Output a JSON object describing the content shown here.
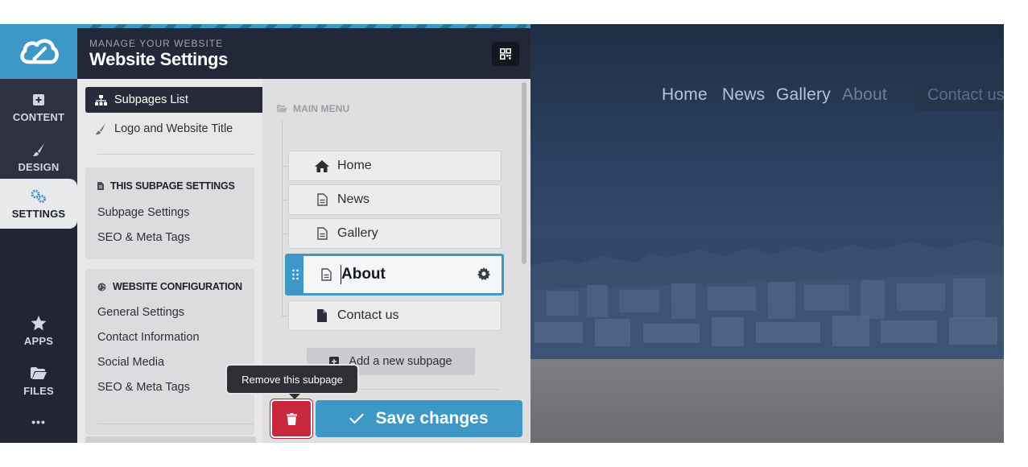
{
  "header": {
    "kicker": "MANAGE YOUR WEBSITE",
    "title": "Website Settings"
  },
  "rail": {
    "items": [
      {
        "label": "CONTENT",
        "icon": "plus-square-icon"
      },
      {
        "label": "DESIGN",
        "icon": "brush-icon"
      },
      {
        "label": "SETTINGS",
        "icon": "gears-icon",
        "active": true
      },
      {
        "label": "APPS",
        "icon": "star-icon"
      },
      {
        "label": "FILES",
        "icon": "folder-icon"
      },
      {
        "label": "•••",
        "icon": "more-icon"
      }
    ]
  },
  "settings_nav": {
    "top_items": [
      {
        "label": "Subpages List",
        "icon": "sitemap-icon",
        "active": true
      },
      {
        "label": "Logo and Website Title",
        "icon": "brush-icon"
      }
    ],
    "subpage_section": {
      "heading": "THIS SUBPAGE SETTINGS",
      "links": [
        "Subpage Settings",
        "SEO & Meta Tags"
      ]
    },
    "website_section": {
      "heading": "WEBSITE CONFIGURATION",
      "links": [
        "General Settings",
        "Contact Information",
        "Social Media",
        "SEO & Meta Tags"
      ]
    }
  },
  "tree": {
    "heading": "MAIN MENU",
    "pages": [
      {
        "label": "Home",
        "icon": "home-icon"
      },
      {
        "label": "News",
        "icon": "file-outline-icon"
      },
      {
        "label": "Gallery",
        "icon": "file-outline-icon"
      },
      {
        "label": "About",
        "icon": "file-outline-icon",
        "selected": true
      },
      {
        "label": "Contact us",
        "icon": "file-solid-icon"
      }
    ],
    "add_label": "Add a new subpage"
  },
  "actions": {
    "tooltip": "Remove this subpage",
    "save_label": "Save changes"
  },
  "preview": {
    "nav": [
      "Home",
      "News",
      "Gallery",
      "About"
    ],
    "contact": "Contact us"
  },
  "colors": {
    "accent": "#3d98c8",
    "danger": "#c8283d",
    "dark": "#222634"
  }
}
